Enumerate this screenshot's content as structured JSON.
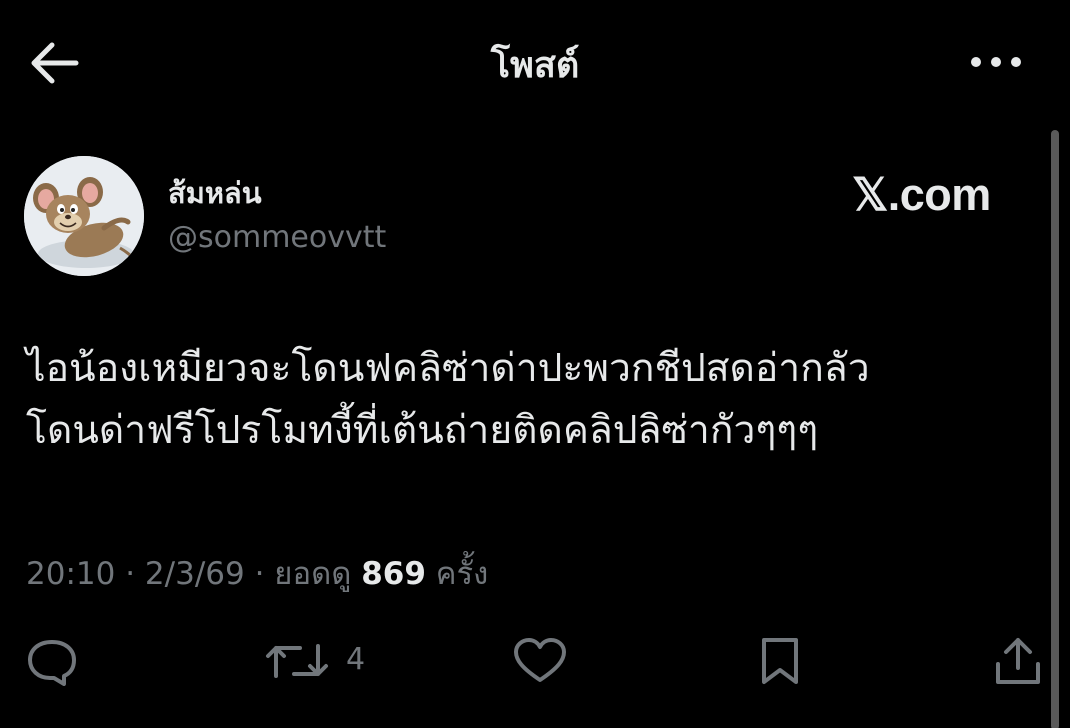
{
  "header": {
    "title": "โพสต์",
    "back_icon": "arrow-left-icon",
    "more_icon": "more-horizontal-icon"
  },
  "author": {
    "name": "ส้มหล่น",
    "handle": "@sommeovvtt",
    "avatar": "cartoon-mouse-avatar"
  },
  "watermark": "𝕏.com",
  "tweet": {
    "lines": [
      "ไอน้องเหมียวจะโดนฟคลิซ่าด่าปะพวกชีปสดอ่ากลัว",
      "โดนด่าฟรีโปรโมทงี้ที่เต้นถ่ายติดคลิปลิซ่ากัวๆๆๆ"
    ]
  },
  "meta": {
    "time": "20:10",
    "separator": "·",
    "date": "2/3/69",
    "views_label": "ยอดดู",
    "views_count": "869",
    "views_suffix": "ครั้ง"
  },
  "actions": {
    "reply_icon": "reply-icon",
    "retweet_icon": "retweet-icon",
    "retweet_count": "4",
    "like_icon": "heart-icon",
    "bookmark_icon": "bookmark-icon",
    "share_icon": "share-icon"
  },
  "colors": {
    "background": "#000000",
    "text_primary": "#e7e9ea",
    "text_secondary": "#71767b"
  }
}
